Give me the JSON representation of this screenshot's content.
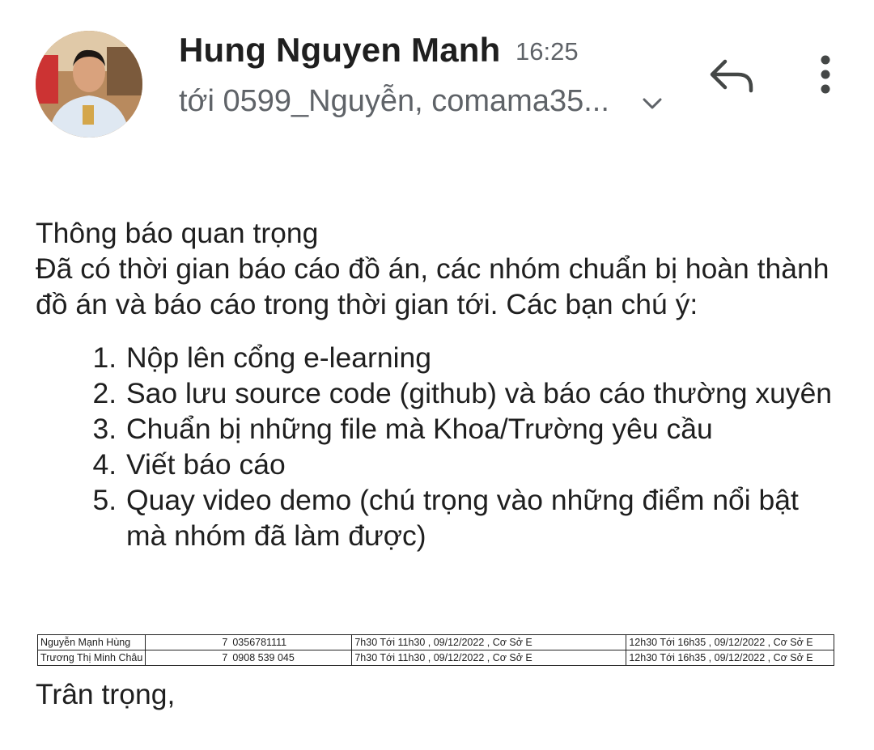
{
  "header": {
    "sender": "Hung Nguyen Manh",
    "time": "16:25",
    "recipients": "tới 0599_Nguyễn, comama35..."
  },
  "icons": {
    "avatar": "avatar",
    "expand": "chevron-down-icon",
    "reply": "reply-icon",
    "more": "more-vert-icon"
  },
  "colors": {
    "secondary_text": "#5f6368",
    "primary_text": "#1f1f1f"
  },
  "body": {
    "line1": "Thông báo quan trọng",
    "line2": "Đã có thời gian báo cáo đồ án, các nhóm chuẩn bị hoàn thành đồ án và báo cáo trong thời gian tới. Các bạn chú ý:",
    "items": [
      "Nộp lên cổng e-learning",
      "Sao lưu source code (github) và báo cáo thường xuyên",
      "Chuẩn bị những file mà Khoa/Trường yêu cầu",
      "Viết báo cáo",
      "Quay video demo (chú trọng vào những điểm nổi bật mà nhóm đã làm được)"
    ]
  },
  "schedule": [
    {
      "name": "Nguyễn Mạnh Hùng",
      "group": "7",
      "phone": "0356781111",
      "slot1": "7h30 Tới  11h30 , 09/12/2022 , Cơ Sở E",
      "slot2": "12h30 Tới  16h35 , 09/12/2022 , Cơ Sở E"
    },
    {
      "name": "Trương Thị Minh Châu",
      "group": "7",
      "phone": "0908 539 045",
      "slot1": "7h30 Tới  11h30 , 09/12/2022 , Cơ Sở E",
      "slot2": "12h30 Tới  16h35 , 09/12/2022 , Cơ Sở E"
    }
  ],
  "signoff": "Trân trọng,"
}
